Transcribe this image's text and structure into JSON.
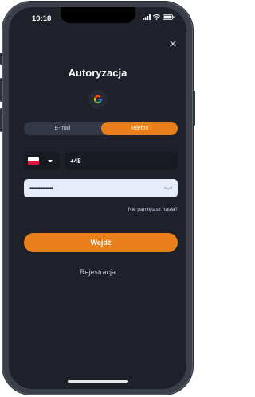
{
  "status_bar": {
    "time": "10:18",
    "icons": [
      "signal-icon",
      "wifi-icon",
      "battery-icon"
    ]
  },
  "screen": {
    "close_icon": "close-icon",
    "title": "Autoryzacja",
    "google_icon": "google-icon"
  },
  "tabs": [
    {
      "label": "E-mail",
      "active": false
    },
    {
      "label": "Telefon",
      "active": true
    }
  ],
  "phone": {
    "country_flag": "poland-flag-icon",
    "value": "+48"
  },
  "password": {
    "value": "••••••••••••••••",
    "toggle_icon": "eye-icon"
  },
  "forgot_link": "Nie pamiętasz hasła?",
  "login_button": "Wejdź",
  "register_link": "Rejestracja",
  "colors": {
    "accent": "#e97f1a",
    "background": "#1e2129",
    "field": "#171a21",
    "password_field": "#e8ecf8"
  }
}
